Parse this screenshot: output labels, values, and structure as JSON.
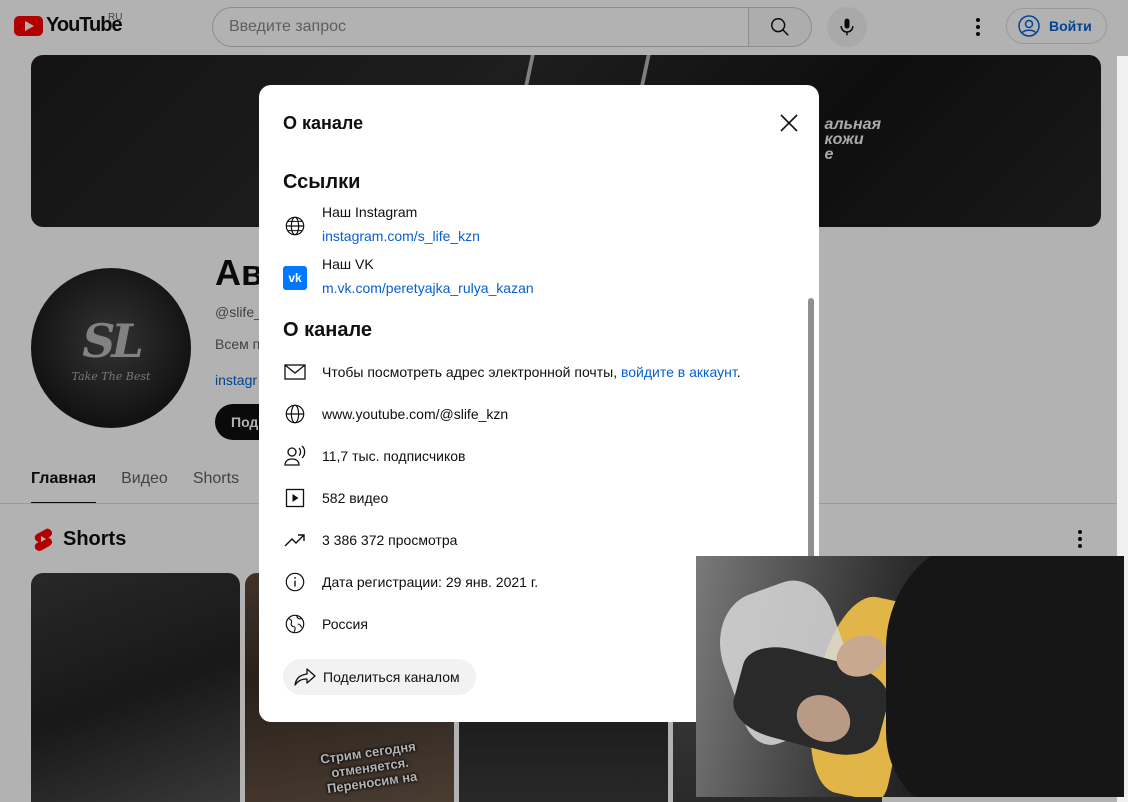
{
  "header": {
    "logo_text": "YouTube",
    "region": "RU",
    "search_placeholder": "Введите запрос",
    "signin_label": "Войти"
  },
  "banner": {
    "tagline_line1": "альная",
    "tagline_line2": "кожи",
    "tagline_line3": "е"
  },
  "channel": {
    "name_partial": "Ав",
    "handle_partial": "@slife_",
    "desc_partial": "Всем п",
    "link_partial": "instagr",
    "subscribe_partial": "Поді",
    "avatar_tagline": "Take The Best"
  },
  "tabs": [
    {
      "label": "Главная"
    },
    {
      "label": "Видео"
    },
    {
      "label": "Shorts"
    }
  ],
  "shorts": {
    "title": "Shorts",
    "overlay_text": "Стрим сегодня отменяется. Переносим на"
  },
  "dialog": {
    "title": "О канале",
    "links_heading": "Ссылки",
    "links": [
      {
        "title": "Наш Instagram",
        "url": "instagram.com/s_life_kzn",
        "icon": "globe-icon"
      },
      {
        "title": "Наш VK",
        "url": "m.vk.com/peretyajka_rulya_kazan",
        "icon": "vk-icon"
      }
    ],
    "about_heading": "О канале",
    "email_text": "Чтобы посмотреть адрес электронной почты, ",
    "email_link": "войдите в аккаунт",
    "email_suffix": ".",
    "channel_url": "www.youtube.com/@slife_kzn",
    "subscribers": "11,7 тыс. подписчиков",
    "videos": "582 видео",
    "views": "3 386 372 просмотра",
    "joined": "Дата регистрации: 29 янв. 2021 г.",
    "country": "Россия",
    "share_label": "Поделиться каналом"
  },
  "colors": {
    "accent_link": "#065fd4",
    "brand_red": "#ff0000"
  }
}
